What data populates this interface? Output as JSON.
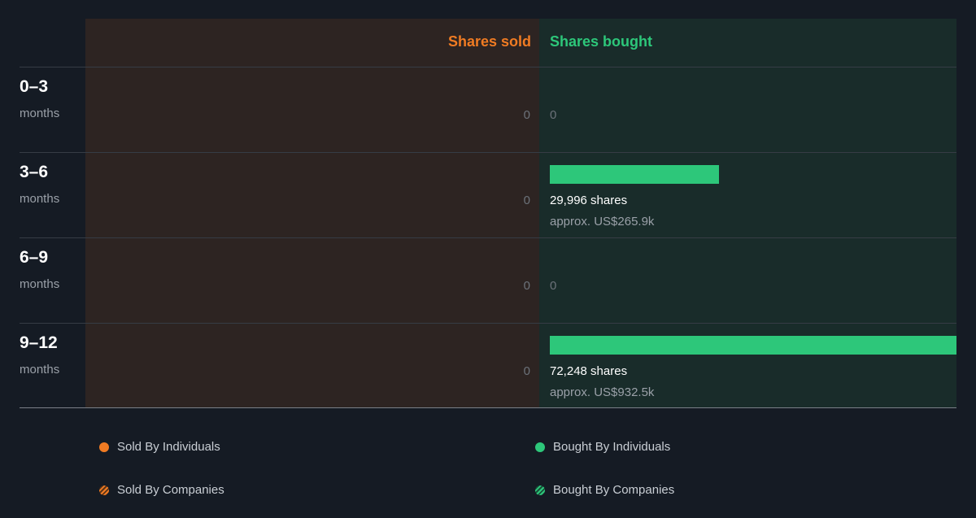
{
  "colors": {
    "sold": "#f07b23",
    "bought": "#2dc77a"
  },
  "header": {
    "sold_label": "Shares sold",
    "bought_label": "Shares bought"
  },
  "rows": [
    {
      "period": "0–3",
      "unit": "months",
      "sold": "0",
      "bought_shares": 0,
      "bought_text": "0",
      "approx": ""
    },
    {
      "period": "3–6",
      "unit": "months",
      "sold": "0",
      "bought_shares": 29996,
      "bought_text": "29,996 shares",
      "approx": "approx. US$265.9k"
    },
    {
      "period": "6–9",
      "unit": "months",
      "sold": "0",
      "bought_shares": 0,
      "bought_text": "0",
      "approx": ""
    },
    {
      "period": "9–12",
      "unit": "months",
      "sold": "0",
      "bought_shares": 72248,
      "bought_text": "72,248 shares",
      "approx": "approx. US$932.5k"
    }
  ],
  "legend": {
    "sold_individuals": "Sold By Individuals",
    "sold_companies": "Sold By Companies",
    "bought_individuals": "Bought By Individuals",
    "bought_companies": "Bought By Companies"
  },
  "chart_data": {
    "type": "bar",
    "categories": [
      "0–3",
      "3–6",
      "6–9",
      "9–12"
    ],
    "series": [
      {
        "name": "Shares sold",
        "values": [
          0,
          0,
          0,
          0
        ]
      },
      {
        "name": "Shares bought",
        "values": [
          0,
          29996,
          0,
          72248
        ]
      }
    ],
    "approx_values": [
      "",
      "approx. US$265.9k",
      "",
      "approx. US$932.5k"
    ],
    "xlabel": "",
    "ylabel": "",
    "grid": true,
    "legend": [
      "Sold By Individuals",
      "Sold By Companies",
      "Bought By Individuals",
      "Bought By Companies"
    ],
    "legend_placement": "bottom"
  }
}
